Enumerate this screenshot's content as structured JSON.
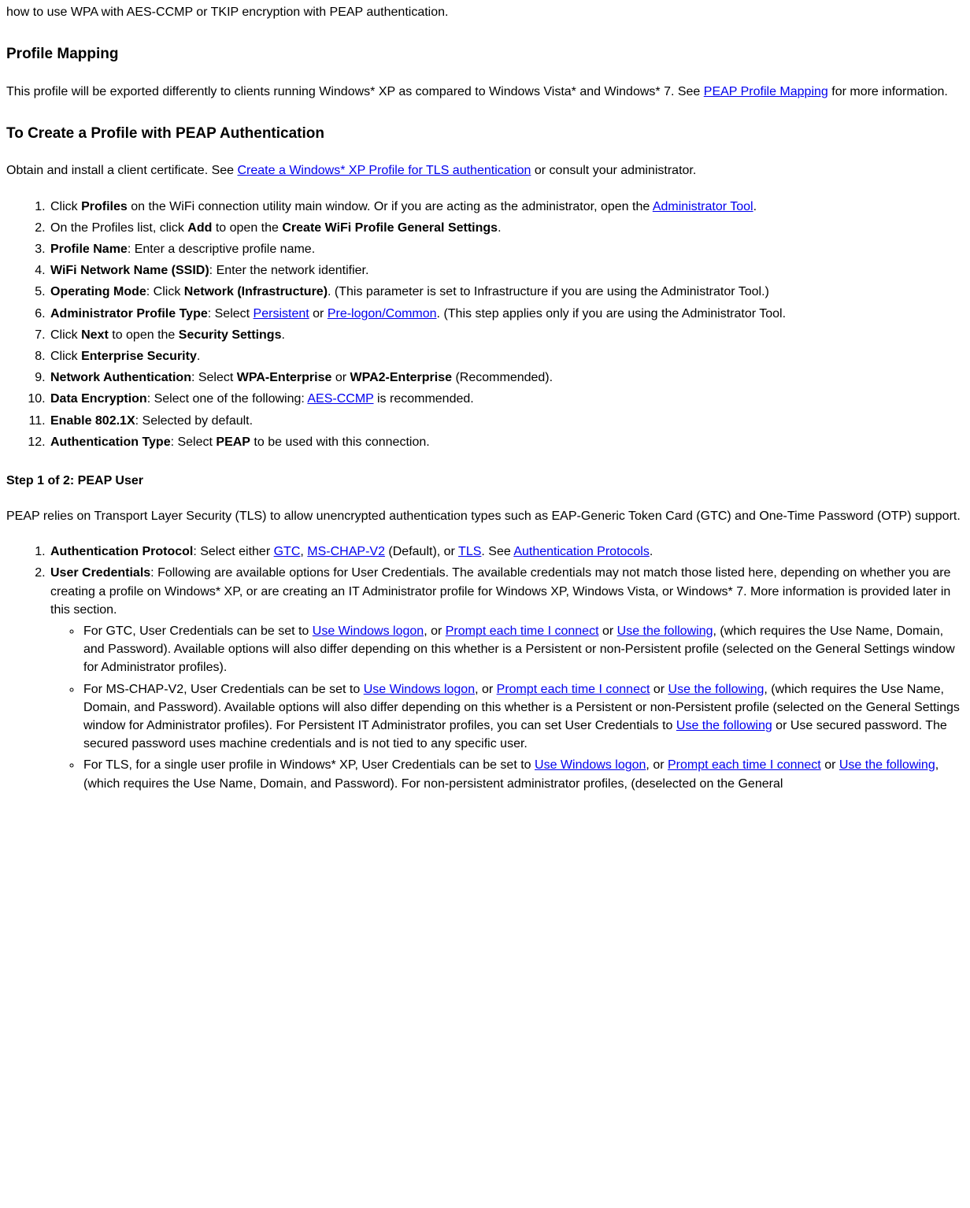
{
  "intro_fragment": "how to use WPA with AES-CCMP or TKIP encryption with PEAP authentication.",
  "h_profile_mapping": "Profile Mapping",
  "p_profile_mapping_1": "This profile will be exported differently to clients running Windows* XP as compared to Windows Vista* and Windows* 7. See ",
  "link_peap_profile_mapping": "PEAP Profile Mapping",
  "p_profile_mapping_2": " for more information.",
  "h_create_profile": "To Create a Profile with PEAP Authentication",
  "p_obtain_1": "Obtain and install a client certificate. See ",
  "link_tls_auth": "Create a Windows* XP Profile for TLS authentication",
  "p_obtain_2": " or consult your administrator.",
  "steps1": {
    "s1_a": "Click ",
    "s1_b": "Profiles",
    "s1_c": " on the WiFi connection utility main window. Or if you are acting as the administrator, open the ",
    "s1_link": "Administrator Tool",
    "s1_d": ".",
    "s2_a": "On the Profiles list, click ",
    "s2_b": "Add",
    "s2_c": " to open the ",
    "s2_d": "Create WiFi Profile General Settings",
    "s2_e": ".",
    "s3_a": "Profile Name",
    "s3_b": ": Enter a descriptive profile name.",
    "s4_a": "WiFi Network Name (SSID)",
    "s4_b": ": Enter the network identifier.",
    "s5_a": "Operating Mode",
    "s5_b": ": Click ",
    "s5_c": "Network (Infrastructure)",
    "s5_d": ". (This parameter is set to Infrastructure if you are using the Administrator Tool.)",
    "s6_a": "Administrator Profile Type",
    "s6_b": ": Select ",
    "s6_link1": "Persistent",
    "s6_c": " or ",
    "s6_link2": "Pre-logon/Common",
    "s6_d": ". (This step applies only if you are using the Administrator Tool.",
    "s7_a": "Click ",
    "s7_b": "Next",
    "s7_c": " to open the ",
    "s7_d": "Security Settings",
    "s7_e": ".",
    "s8_a": "Click ",
    "s8_b": "Enterprise Security",
    "s8_c": ".",
    "s9_a": "Network Authentication",
    "s9_b": ": Select ",
    "s9_c": "WPA-Enterprise",
    "s9_d": " or ",
    "s9_e": "WPA2-Enterprise",
    "s9_f": " (Recommended).",
    "s10_a": "Data Encryption",
    "s10_b": ": Select one of the following: ",
    "s10_link": "AES-CCMP",
    "s10_c": " is recommended.",
    "s11_a": "Enable 802.1X",
    "s11_b": ": Selected by default.",
    "s12_a": "Authentication Type",
    "s12_b": ": Select ",
    "s12_c": "PEAP",
    "s12_d": " to be used with this connection."
  },
  "h_step1": "Step 1 of 2: PEAP User",
  "p_peap_relies": "PEAP relies on Transport Layer Security (TLS) to allow unencrypted authentication types such as EAP-Generic Token Card (GTC) and One-Time Password (OTP) support.",
  "steps2": {
    "s1_a": "Authentication Protocol",
    "s1_b": ": Select either ",
    "s1_link1": "GTC",
    "s1_c": ", ",
    "s1_link2": "MS-CHAP-V2",
    "s1_d": " (Default), or ",
    "s1_link3": "TLS",
    "s1_e": ". See ",
    "s1_link4": "Authentication Protocols",
    "s1_f": ".",
    "s2_a": "User Credentials",
    "s2_b": ": Following are available options for User Credentials. The available credentials may not match those listed here, depending on whether you are creating a profile on Windows* XP, or are creating an IT Administrator profile for Windows XP, Windows Vista, or Windows* 7. More information is provided later in this section.",
    "b1_a": "For GTC, User Credentials can be set to ",
    "b1_link1": "Use Windows logon",
    "b1_b": ", or ",
    "b1_link2": "Prompt each time I connect",
    "b1_c": " or ",
    "b1_link3": "Use the following",
    "b1_d": ", (which requires the Use Name, Domain, and Password). Available options will also differ depending on this whether is a Persistent or non-Persistent profile (selected on the General Settings window for Administrator profiles).",
    "b2_a": "For MS-CHAP-V2, User Credentials can be set to ",
    "b2_link1": "Use Windows logon",
    "b2_b": ", or ",
    "b2_link2": "Prompt each time I connect",
    "b2_c": " or ",
    "b2_link3": "Use the following",
    "b2_d": ", (which requires the Use Name, Domain, and Password). Available options will also differ depending on this whether is a Persistent or non-Persistent profile (selected on the General Settings window for Administrator profiles). For Persistent IT Administrator profiles, you can set User Credentials to ",
    "b2_link4": "Use the following",
    "b2_e": " or Use secured password. The secured password uses machine credentials and is not tied to any specific user.",
    "b3_a": "For TLS, for a single user profile in Windows* XP, User Credentials can be set to ",
    "b3_link1": "Use Windows logon",
    "b3_b": ", or ",
    "b3_link2": "Prompt each time I connect",
    "b3_c": " or ",
    "b3_link3": "Use the following",
    "b3_d": ", (which requires the Use Name, Domain, and Password). For non-persistent administrator profiles, (deselected on the General"
  }
}
